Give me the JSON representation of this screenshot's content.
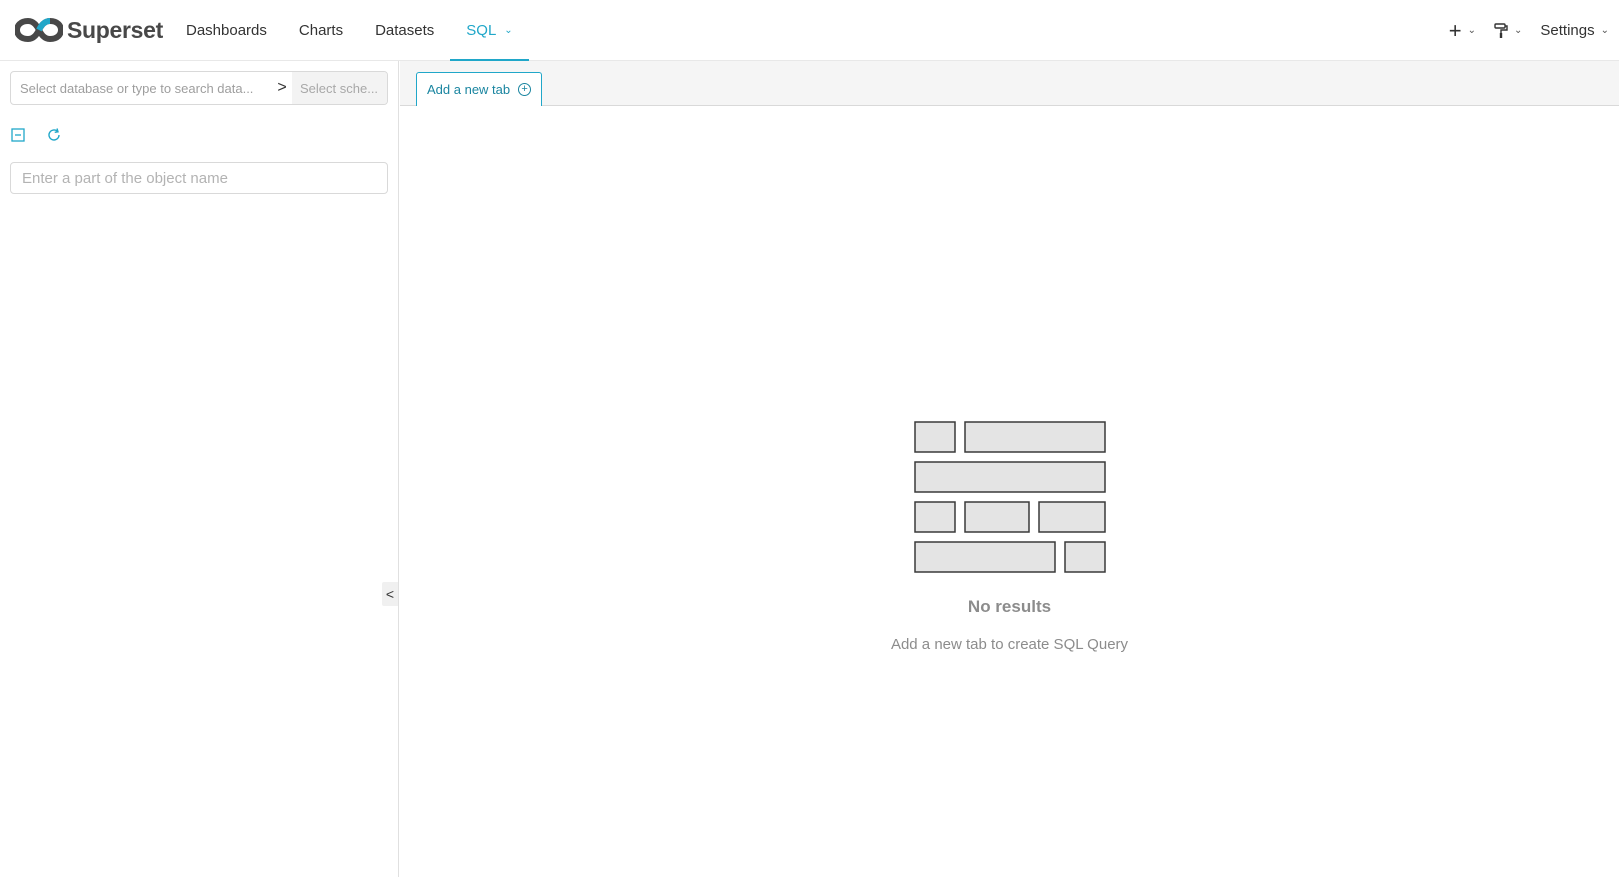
{
  "brand": {
    "name": "Superset"
  },
  "nav": {
    "links": [
      {
        "label": "Dashboards"
      },
      {
        "label": "Charts"
      },
      {
        "label": "Datasets"
      },
      {
        "label": "SQL"
      }
    ],
    "settings_label": "Settings"
  },
  "sidebar": {
    "database_placeholder": "Select database or type to search data...",
    "schema_placeholder": "Select sche...",
    "object_search_placeholder": "Enter a part of the object name"
  },
  "tabs": {
    "add_tab_label": "Add a new tab"
  },
  "empty_state": {
    "title": "No results",
    "description": "Add a new tab to create SQL Query"
  },
  "colors": {
    "accent": "#20a7c9",
    "text": "#333333",
    "muted": "#8c8c8c"
  },
  "icons": {
    "logo": "superset-infinity-icon",
    "plus": "plus-icon",
    "theme": "paint-roller-icon",
    "collapse": "collapse-all-icon",
    "refresh": "refresh-icon"
  }
}
